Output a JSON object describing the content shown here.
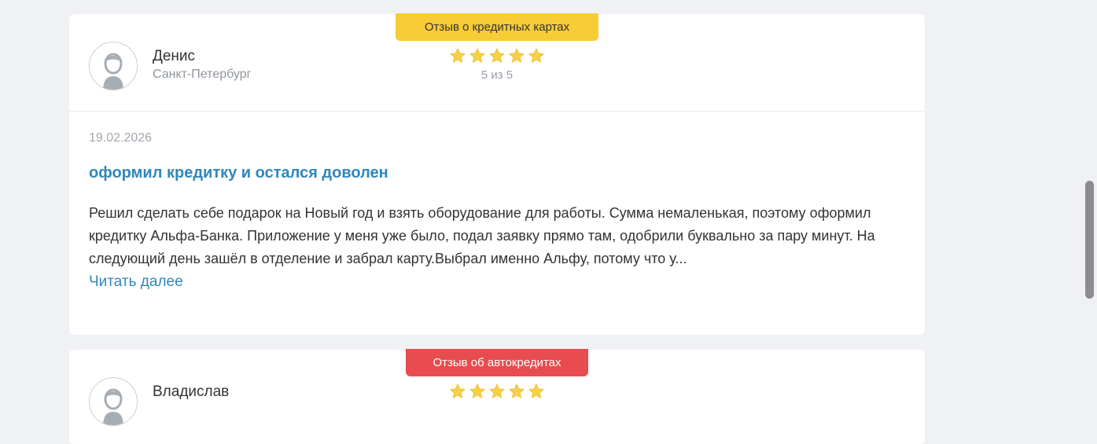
{
  "reviews": [
    {
      "badge": "Отзыв о кредитных картах",
      "badge_color": "#f7cc34",
      "author": "Денис",
      "city": "Санкт-Петербург",
      "rating": 5,
      "rating_text": "5 из 5",
      "date": "19.02.2026",
      "title": "оформил кредитку и остался доволен",
      "text": "Решил сделать себе подарок на Новый год и взять оборудование для работы. Сумма немаленькая, поэтому оформил кредитку Альфа-Банка. Приложение у меня уже было, подал заявку прямо там, одобрили буквально за пару минут. На следующий день зашёл в отделение и забрал карту.Выбрал именно Альфу, потому что у...",
      "read_more": "Читать далее"
    },
    {
      "badge": "Отзыв об автокредитах",
      "badge_color": "#e84c4e",
      "author": "Владислав",
      "rating": 5
    }
  ],
  "colors": {
    "star": "#f7d046",
    "link": "#3087bd",
    "background": "#eff1f4"
  },
  "icons": {
    "avatar": "user-avatar-icon",
    "star": "star-icon"
  }
}
